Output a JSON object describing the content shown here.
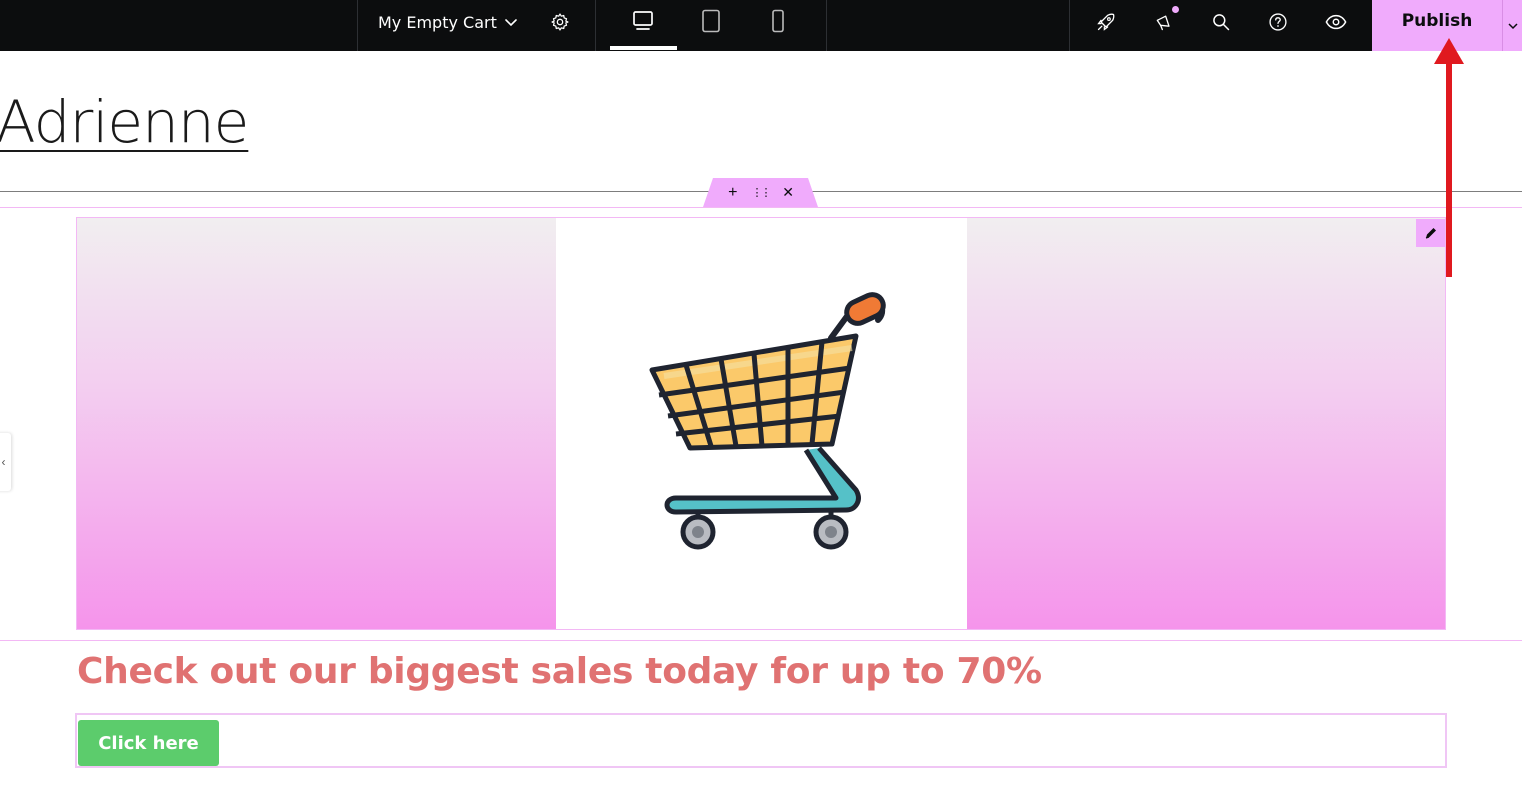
{
  "topbar": {
    "document_title": "My Empty Cart",
    "publish_label": "Publish",
    "icons": {
      "dropdown": "chevron-down-icon",
      "settings": "gear-icon",
      "desktop": "desktop-icon",
      "tablet": "tablet-icon",
      "mobile": "mobile-icon",
      "launch": "rocket-icon",
      "notifications": "megaphone-icon",
      "search": "search-icon",
      "help": "help-icon",
      "preview": "eye-icon"
    },
    "active_device": "desktop"
  },
  "canvas": {
    "site_title": "Adrienne",
    "section_handle": {
      "add": "+",
      "move": "⋮⋮",
      "delete": "✕"
    },
    "hero": {
      "image": "shopping-cart-illustration"
    },
    "promo_heading": "Check out our biggest sales today for up to 70%",
    "cta_label": "Click here"
  },
  "colors": {
    "accent": "#f0abfc",
    "topbar": "#0c0d0e",
    "promo_text": "#e07272",
    "cta": "#5ccc6c",
    "annotation_arrow": "#e0191f"
  }
}
